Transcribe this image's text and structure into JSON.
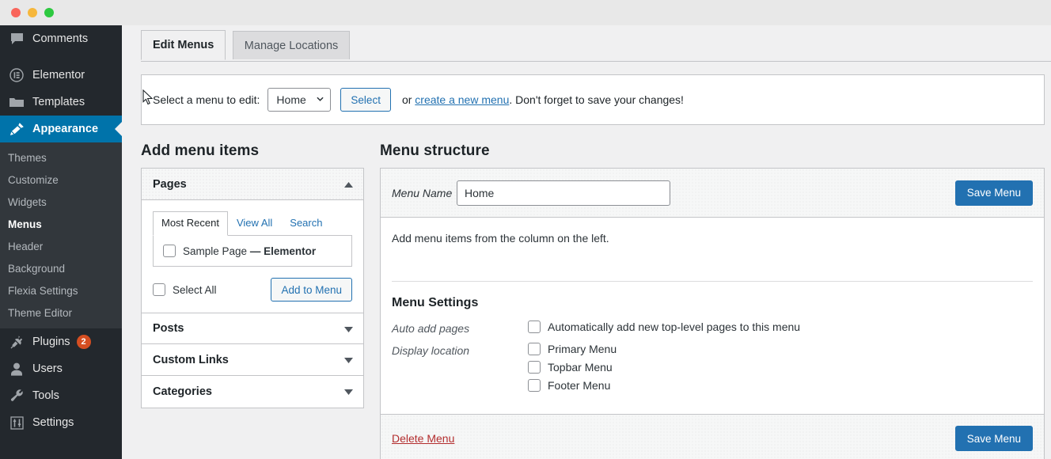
{
  "window": {
    "traffic_lights": [
      "close",
      "minimize",
      "maximize"
    ]
  },
  "sidebar": {
    "items": [
      {
        "label": "Comments",
        "icon": "comment-icon",
        "active": false
      },
      {
        "label": "Elementor",
        "icon": "elementor-icon",
        "active": false
      },
      {
        "label": "Templates",
        "icon": "folder-icon",
        "active": false
      },
      {
        "label": "Appearance",
        "icon": "paintbrush-icon",
        "active": true
      },
      {
        "label": "Plugins",
        "icon": "plug-icon",
        "active": false,
        "badge": "2"
      },
      {
        "label": "Users",
        "icon": "user-icon",
        "active": false
      },
      {
        "label": "Tools",
        "icon": "wrench-icon",
        "active": false
      },
      {
        "label": "Settings",
        "icon": "sliders-icon",
        "active": false
      }
    ],
    "appearance_submenu": [
      {
        "label": "Themes",
        "current": false
      },
      {
        "label": "Customize",
        "current": false
      },
      {
        "label": "Widgets",
        "current": false
      },
      {
        "label": "Menus",
        "current": true
      },
      {
        "label": "Header",
        "current": false
      },
      {
        "label": "Background",
        "current": false
      },
      {
        "label": "Flexia Settings",
        "current": false
      },
      {
        "label": "Theme Editor",
        "current": false
      }
    ]
  },
  "tabs": [
    {
      "label": "Edit Menus",
      "active": true
    },
    {
      "label": "Manage Locations",
      "active": false
    }
  ],
  "notice": {
    "prefix": "Select a menu to edit:",
    "select_value": "Home",
    "select_options": [
      "Home"
    ],
    "select_button": "Select",
    "or": "or",
    "create_link": "create a new menu",
    "suffix": ". Don't forget to save your changes!"
  },
  "add_items": {
    "heading": "Add menu items",
    "accordions": [
      {
        "label": "Pages",
        "expanded": true
      },
      {
        "label": "Posts",
        "expanded": false
      },
      {
        "label": "Custom Links",
        "expanded": false
      },
      {
        "label": "Categories",
        "expanded": false
      }
    ],
    "pages_panel": {
      "tabs": [
        {
          "label": "Most Recent",
          "active": true
        },
        {
          "label": "View All",
          "active": false
        },
        {
          "label": "Search",
          "active": false
        }
      ],
      "items": [
        {
          "label": "Sample Page",
          "suffix": " — Elementor",
          "checked": false
        }
      ],
      "select_all_label": "Select All",
      "select_all_checked": false,
      "add_button": "Add to Menu"
    }
  },
  "menu_structure": {
    "heading": "Menu structure",
    "name_label": "Menu Name",
    "name_value": "Home",
    "name_placeholder": "Menu Name",
    "save_top": "Save Menu",
    "save_bottom": "Save Menu",
    "hint": "Add menu items from the column on the left.",
    "settings_heading": "Menu Settings",
    "auto_add_label": "Auto add pages",
    "auto_add_option": "Automatically add new top-level pages to this menu",
    "auto_add_checked": false,
    "display_location_label": "Display location",
    "locations": [
      {
        "label": "Primary Menu",
        "checked": false
      },
      {
        "label": "Topbar Menu",
        "checked": false
      },
      {
        "label": "Footer Menu",
        "checked": false
      }
    ],
    "delete_link": "Delete Menu"
  },
  "colors": {
    "accent": "#2271b1",
    "sidebar_active": "#0073aa",
    "sidebar_bg": "#23282d",
    "submenu_bg": "#32373c",
    "badge": "#d54e21",
    "danger": "#b32d2e",
    "page_bg": "#f0f0f1"
  }
}
